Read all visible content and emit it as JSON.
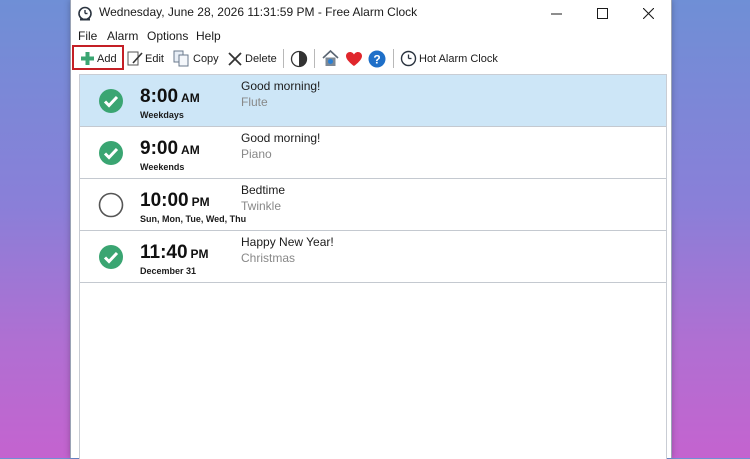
{
  "window": {
    "title": "Wednesday, June 28, 2026 11:31:59 PM - Free Alarm Clock"
  },
  "menu": [
    "File",
    "Alarm",
    "Options",
    "Help"
  ],
  "toolbar": {
    "add_label": "Add",
    "edit_label": "Edit",
    "copy_label": "Copy",
    "delete_label": "Delete",
    "hot_alarm_label": "Hot Alarm Clock"
  },
  "colors": {
    "selected_row": "#cde6f7",
    "enabled_check": "#3aa572",
    "highlight_box": "#c41f25",
    "heart": "#e0262c",
    "help": "#1e6fc8"
  },
  "alarms": [
    {
      "time": "8:00",
      "ampm": "AM",
      "days": "Weekdays",
      "label": "Good morning!",
      "sound": "Flute",
      "enabled": true,
      "selected": true
    },
    {
      "time": "9:00",
      "ampm": "AM",
      "days": "Weekends",
      "label": "Good morning!",
      "sound": "Piano",
      "enabled": true,
      "selected": false
    },
    {
      "time": "10:00",
      "ampm": "PM",
      "days": "Sun, Mon, Tue, Wed, Thu",
      "label": "Bedtime",
      "sound": "Twinkle",
      "enabled": false,
      "selected": false
    },
    {
      "time": "11:40",
      "ampm": "PM",
      "days": "December 31",
      "label": "Happy New Year!",
      "sound": "Christmas",
      "enabled": true,
      "selected": false
    }
  ]
}
